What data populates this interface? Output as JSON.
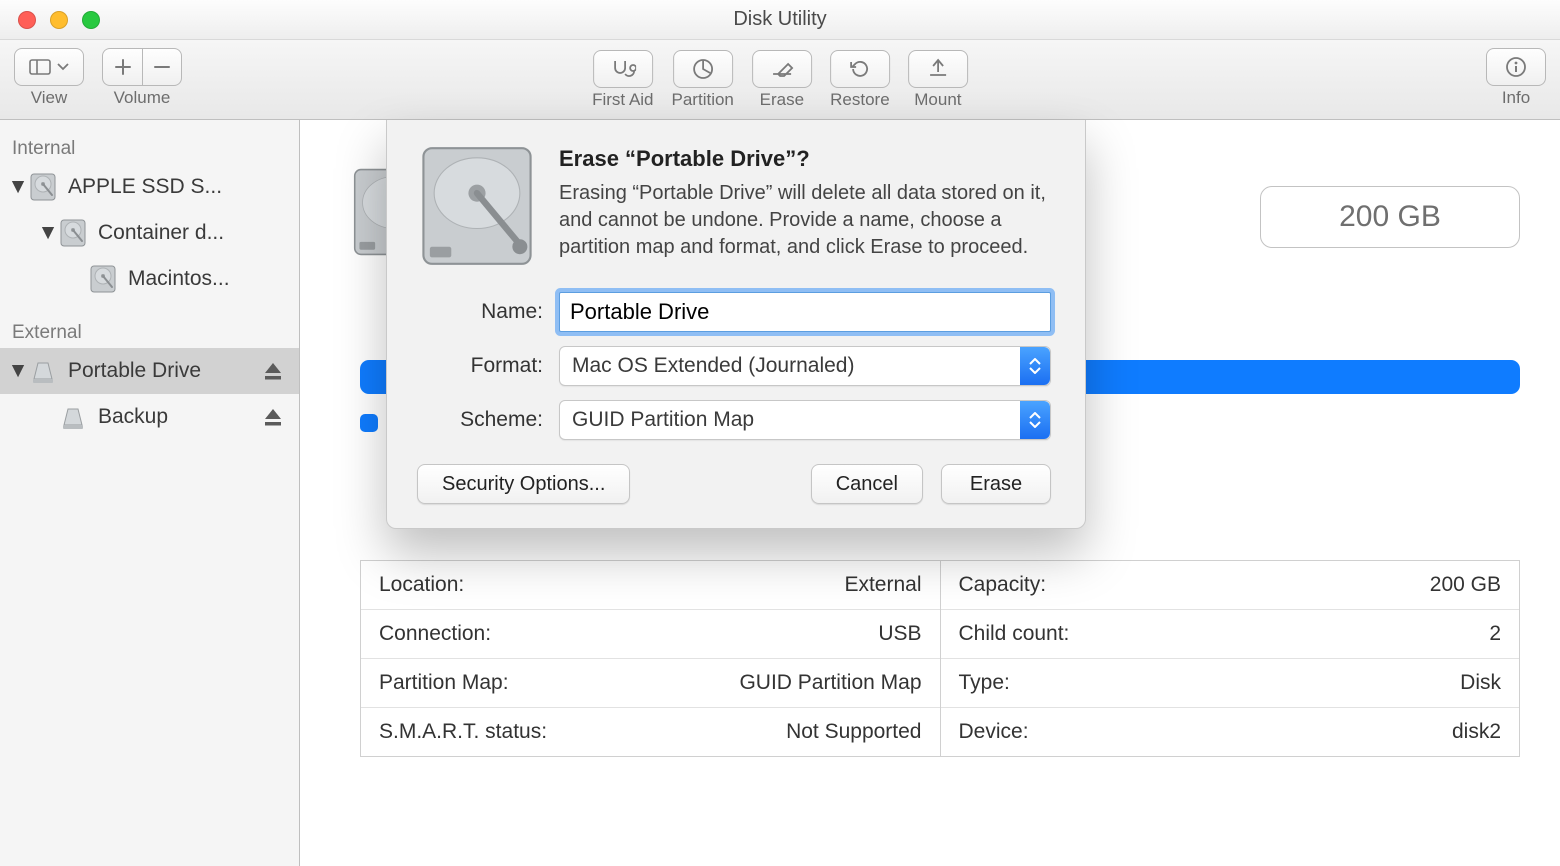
{
  "window_title": "Disk Utility",
  "toolbar": {
    "view": "View",
    "volume": "Volume",
    "first_aid": "First Aid",
    "partition": "Partition",
    "erase": "Erase",
    "restore": "Restore",
    "mount": "Mount",
    "info": "Info"
  },
  "sidebar": {
    "internal_label": "Internal",
    "external_label": "External",
    "internal": [
      {
        "name": "APPLE SSD S..."
      },
      {
        "name": "Container d..."
      },
      {
        "name": "Macintos..."
      }
    ],
    "external": [
      {
        "name": "Portable Drive"
      },
      {
        "name": "Backup"
      }
    ]
  },
  "capacity_badge": "200 GB",
  "details": {
    "left": [
      {
        "label": "Location:",
        "value": "External"
      },
      {
        "label": "Connection:",
        "value": "USB"
      },
      {
        "label": "Partition Map:",
        "value": "GUID Partition Map"
      },
      {
        "label": "S.M.A.R.T. status:",
        "value": "Not Supported"
      }
    ],
    "right": [
      {
        "label": "Capacity:",
        "value": "200 GB"
      },
      {
        "label": "Child count:",
        "value": "2"
      },
      {
        "label": "Type:",
        "value": "Disk"
      },
      {
        "label": "Device:",
        "value": "disk2"
      }
    ]
  },
  "dialog": {
    "title": "Erase “Portable Drive”?",
    "body": "Erasing “Portable Drive” will delete all data stored on it, and cannot be undone. Provide a name, choose a partition map and format, and click Erase to proceed.",
    "name_label": "Name:",
    "name_value": "Portable Drive",
    "format_label": "Format:",
    "format_value": "Mac OS Extended (Journaled)",
    "scheme_label": "Scheme:",
    "scheme_value": "GUID Partition Map",
    "security": "Security Options...",
    "cancel": "Cancel",
    "erase": "Erase"
  }
}
